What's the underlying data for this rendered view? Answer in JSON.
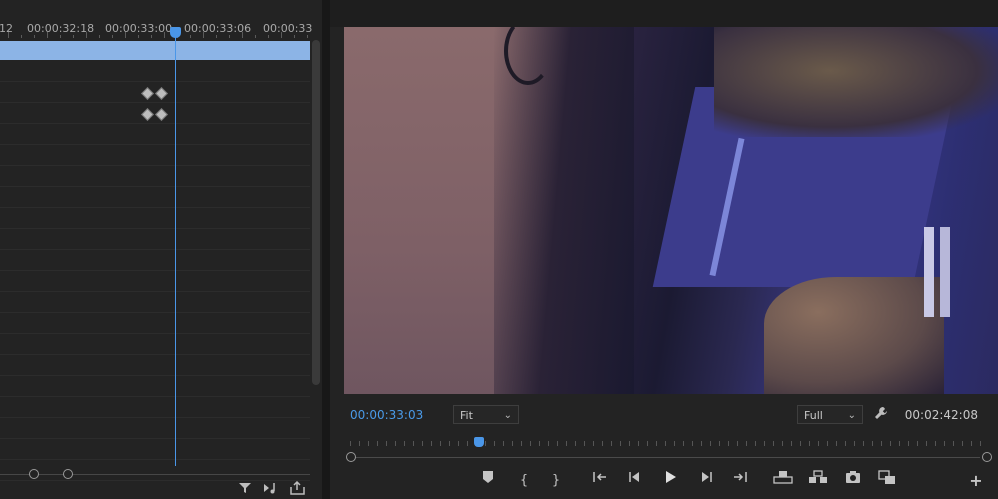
{
  "timeline_ruler": {
    "labels": [
      "12",
      "00:00:32:18",
      "00:00:33:00",
      "00:00:33:06",
      "00:00:33"
    ]
  },
  "program_monitor": {
    "current_timecode": "00:00:33:03",
    "duration_timecode": "00:02:42:08",
    "zoom_select": {
      "selected": "Fit"
    },
    "resolution_select": {
      "selected": "Full"
    },
    "playhead_position_fraction": 0.205
  },
  "icons": {
    "left_footer": [
      "filter-icon",
      "audio-icon",
      "export-icon"
    ],
    "transport": [
      "add-marker-icon",
      "mark-in-icon",
      "mark-out-icon",
      "go-to-in-icon",
      "step-back-icon",
      "play-icon",
      "step-forward-icon",
      "go-to-out-icon",
      "lift-icon",
      "extract-icon",
      "export-frame-icon",
      "compare-icon",
      "add-button-icon"
    ]
  },
  "colors": {
    "accent": "#4a96e8",
    "clip": "#8cb4e6",
    "panel_bg": "#232323"
  }
}
